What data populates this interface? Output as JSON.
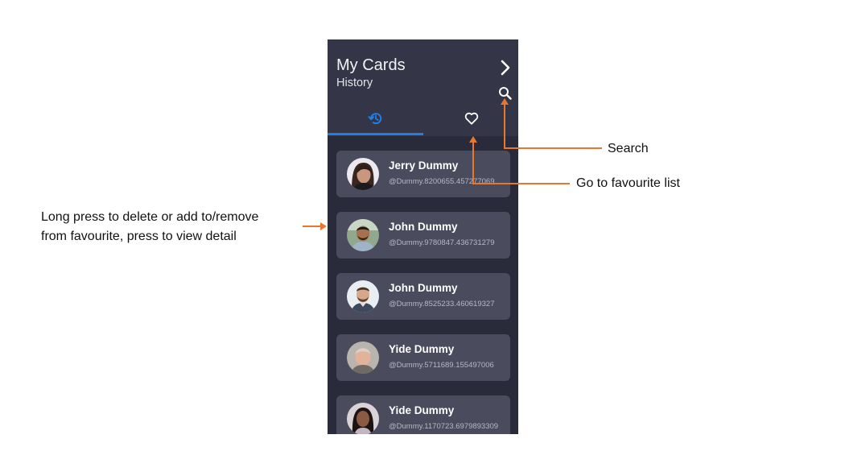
{
  "app": {
    "title": "My Cards",
    "subtitle": "History"
  },
  "tabs": [
    {
      "name": "history",
      "icon": "history-icon",
      "active": true
    },
    {
      "name": "favourite",
      "icon": "heart-outline-icon",
      "active": false
    }
  ],
  "toolbar": {
    "next_icon": "chevron-right-icon",
    "search_icon": "search-icon"
  },
  "cards": [
    {
      "name": "Jerry Dummy",
      "handle": "@Dummy.8200655.457277069"
    },
    {
      "name": "John Dummy",
      "handle": "@Dummy.9780847.436731279"
    },
    {
      "name": "John Dummy",
      "handle": "@Dummy.8525233.460619327"
    },
    {
      "name": "Yide Dummy",
      "handle": "@Dummy.5711689.155497006"
    },
    {
      "name": "Yide Dummy",
      "handle": "@Dummy.1170723.6979893309"
    }
  ],
  "annotations": {
    "long_press_line1": "Long press to delete or add to/remove",
    "long_press_line2": "from favourite, press to view detail",
    "search": "Search",
    "favourite_list": "Go to favourite list"
  },
  "colors": {
    "accent": "#1e7fe8",
    "annotation": "#e8772e",
    "background": "#2a2b3a",
    "card": "#4a4b5c"
  }
}
